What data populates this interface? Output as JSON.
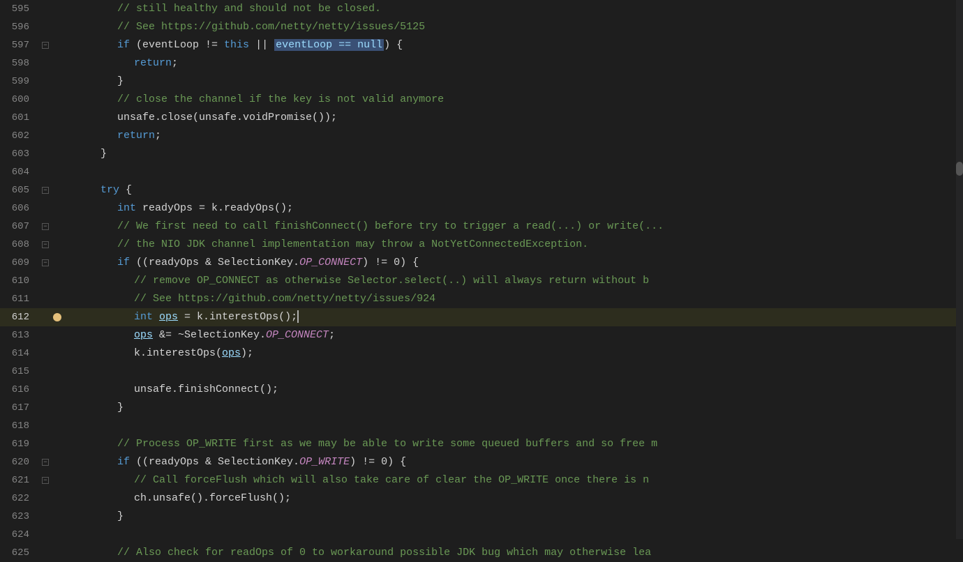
{
  "editor": {
    "lines": [
      {
        "num": "595",
        "fold": false,
        "indent": 3,
        "tokens": [
          {
            "t": "comment",
            "c": "// still healthy and should not be closed."
          }
        ]
      },
      {
        "num": "596",
        "fold": false,
        "indent": 3,
        "tokens": [
          {
            "t": "comment",
            "c": "// See https://github.com/netty/netty/issues/5125"
          }
        ]
      },
      {
        "num": "597",
        "fold": true,
        "indent": 3,
        "tokens": [
          {
            "t": "kw",
            "c": "if"
          },
          {
            "t": "plain",
            "c": " (eventLoop != "
          },
          {
            "t": "kw",
            "c": "this"
          },
          {
            "t": "plain",
            "c": " || "
          },
          {
            "t": "highlight-box",
            "c": "eventLoop == null"
          },
          {
            "t": "plain",
            "c": ") {"
          }
        ]
      },
      {
        "num": "598",
        "fold": false,
        "indent": 4,
        "tokens": [
          {
            "t": "kw",
            "c": "return"
          },
          {
            "t": "plain",
            "c": ";"
          }
        ]
      },
      {
        "num": "599",
        "fold": false,
        "indent": 3,
        "tokens": [
          {
            "t": "plain",
            "c": "}"
          }
        ]
      },
      {
        "num": "600",
        "fold": false,
        "indent": 3,
        "tokens": [
          {
            "t": "comment",
            "c": "// close the channel if the key is not valid anymore"
          }
        ]
      },
      {
        "num": "601",
        "fold": false,
        "indent": 3,
        "tokens": [
          {
            "t": "plain",
            "c": "unsafe.close(unsafe.voidPromise());"
          }
        ]
      },
      {
        "num": "602",
        "fold": false,
        "indent": 3,
        "tokens": [
          {
            "t": "kw",
            "c": "return"
          },
          {
            "t": "plain",
            "c": ";"
          }
        ]
      },
      {
        "num": "603",
        "fold": false,
        "indent": 2,
        "tokens": [
          {
            "t": "plain",
            "c": "}"
          }
        ]
      },
      {
        "num": "604",
        "fold": false,
        "indent": 0,
        "tokens": []
      },
      {
        "num": "605",
        "fold": true,
        "indent": 2,
        "tokens": [
          {
            "t": "kw",
            "c": "try"
          },
          {
            "t": "plain",
            "c": " {"
          }
        ]
      },
      {
        "num": "606",
        "fold": false,
        "indent": 3,
        "tokens": [
          {
            "t": "kw",
            "c": "int"
          },
          {
            "t": "plain",
            "c": " readyOps = k.readyOps();"
          }
        ]
      },
      {
        "num": "607",
        "fold": true,
        "indent": 3,
        "tokens": [
          {
            "t": "comment",
            "c": "// We first need to call finishConnect() before try to trigger a read(...) or write(..."
          }
        ]
      },
      {
        "num": "608",
        "fold": true,
        "indent": 3,
        "tokens": [
          {
            "t": "comment",
            "c": "// the NIO JDK channel implementation may throw a NotYetConnectedException."
          }
        ]
      },
      {
        "num": "609",
        "fold": true,
        "indent": 3,
        "tokens": [
          {
            "t": "kw",
            "c": "if"
          },
          {
            "t": "plain",
            "c": " ((readyOps & SelectionKey."
          },
          {
            "t": "italic-purple",
            "c": "OP_CONNECT"
          },
          {
            "t": "plain",
            "c": ") != 0) {"
          }
        ]
      },
      {
        "num": "610",
        "fold": false,
        "indent": 4,
        "tokens": [
          {
            "t": "comment",
            "c": "// remove OP_CONNECT as otherwise Selector.select(..) will always return without b"
          }
        ]
      },
      {
        "num": "611",
        "fold": false,
        "indent": 4,
        "tokens": [
          {
            "t": "comment",
            "c": "// See https://github.com/netty/netty/issues/924"
          }
        ]
      },
      {
        "num": "612",
        "fold": false,
        "indent": 4,
        "active": true,
        "warning": true,
        "tokens": [
          {
            "t": "kw",
            "c": "int"
          },
          {
            "t": "plain",
            "c": " "
          },
          {
            "t": "underline-var",
            "c": "ops"
          },
          {
            "t": "plain",
            "c": " = k.interestOps();"
          },
          {
            "t": "cursor",
            "c": ""
          }
        ]
      },
      {
        "num": "613",
        "fold": false,
        "indent": 4,
        "tokens": [
          {
            "t": "underline-var",
            "c": "ops"
          },
          {
            "t": "plain",
            "c": " &= ~SelectionKey."
          },
          {
            "t": "italic-purple",
            "c": "OP_CONNECT"
          },
          {
            "t": "plain",
            "c": ";"
          }
        ]
      },
      {
        "num": "614",
        "fold": false,
        "indent": 4,
        "tokens": [
          {
            "t": "plain",
            "c": "k.interestOps("
          },
          {
            "t": "underline-var",
            "c": "ops"
          },
          {
            "t": "plain",
            "c": ");"
          }
        ]
      },
      {
        "num": "615",
        "fold": false,
        "indent": 0,
        "tokens": []
      },
      {
        "num": "616",
        "fold": false,
        "indent": 4,
        "tokens": [
          {
            "t": "plain",
            "c": "unsafe.finishConnect();"
          }
        ]
      },
      {
        "num": "617",
        "fold": false,
        "indent": 3,
        "tokens": [
          {
            "t": "plain",
            "c": "}"
          }
        ]
      },
      {
        "num": "618",
        "fold": false,
        "indent": 0,
        "tokens": []
      },
      {
        "num": "619",
        "fold": false,
        "indent": 3,
        "tokens": [
          {
            "t": "comment",
            "c": "// Process OP_WRITE first as we may be able to write some queued buffers and so free m"
          }
        ]
      },
      {
        "num": "620",
        "fold": true,
        "indent": 3,
        "tokens": [
          {
            "t": "kw",
            "c": "if"
          },
          {
            "t": "plain",
            "c": " ((readyOps & SelectionKey."
          },
          {
            "t": "italic-purple",
            "c": "OP_WRITE"
          },
          {
            "t": "plain",
            "c": ") != 0) {"
          }
        ]
      },
      {
        "num": "621",
        "fold": true,
        "indent": 4,
        "tokens": [
          {
            "t": "comment",
            "c": "// Call forceFlush which will also take care of clear the OP_WRITE once there is n"
          }
        ]
      },
      {
        "num": "622",
        "fold": false,
        "indent": 4,
        "tokens": [
          {
            "t": "plain",
            "c": "ch.unsafe().forceFlush();"
          }
        ]
      },
      {
        "num": "623",
        "fold": false,
        "indent": 3,
        "tokens": [
          {
            "t": "plain",
            "c": "}"
          }
        ]
      },
      {
        "num": "624",
        "fold": false,
        "indent": 0,
        "tokens": []
      },
      {
        "num": "625",
        "fold": false,
        "indent": 3,
        "tokens": [
          {
            "t": "comment",
            "c": "// Also check for readOps of 0 to workaround possible JDK bug which may otherwise lea"
          }
        ]
      }
    ]
  }
}
